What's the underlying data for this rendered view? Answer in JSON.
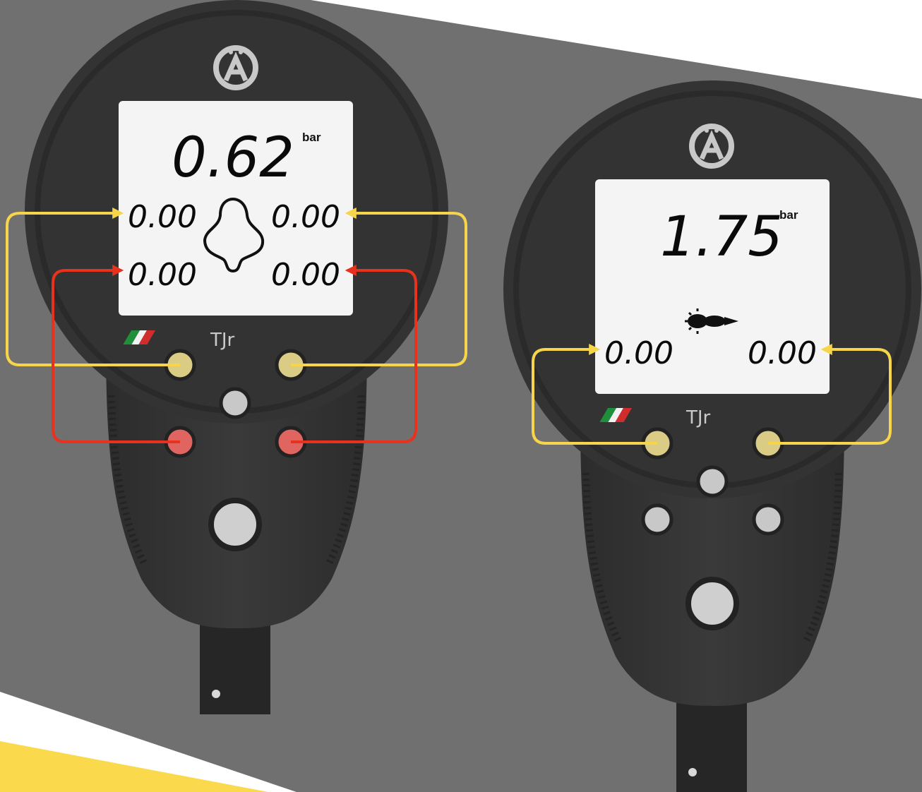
{
  "colors": {
    "background_gray": "#707070",
    "device_body": "#323232",
    "lcd_screen": "#f4f4f4",
    "front_pair_arrow": "#f7d54a",
    "rear_pair_arrow": "#e8321e",
    "button_yellow": "#dacb85",
    "button_red": "#e06560",
    "button_gray": "#c8c8c8",
    "yellow_stripe": "#fbd94c"
  },
  "device_left": {
    "logo_icon": "brand-logo-icon",
    "main_reading": "0.62",
    "main_unit": "bar",
    "vehicle_icon": "car-outline-icon",
    "wheel_readings": {
      "front_left": "0.00",
      "front_right": "0.00",
      "rear_left": "0.00",
      "rear_right": "0.00"
    },
    "brand_mark": "TJr",
    "flag_icon": "italian-flag-icon"
  },
  "device_right": {
    "logo_icon": "brand-logo-icon",
    "main_reading": "1.75",
    "main_unit": "bar",
    "vehicle_icon": "motorcycle-icon",
    "wheel_readings": {
      "front": "0.00",
      "rear": "0.00"
    },
    "brand_mark": "TJr",
    "flag_icon": "italian-flag-icon"
  }
}
